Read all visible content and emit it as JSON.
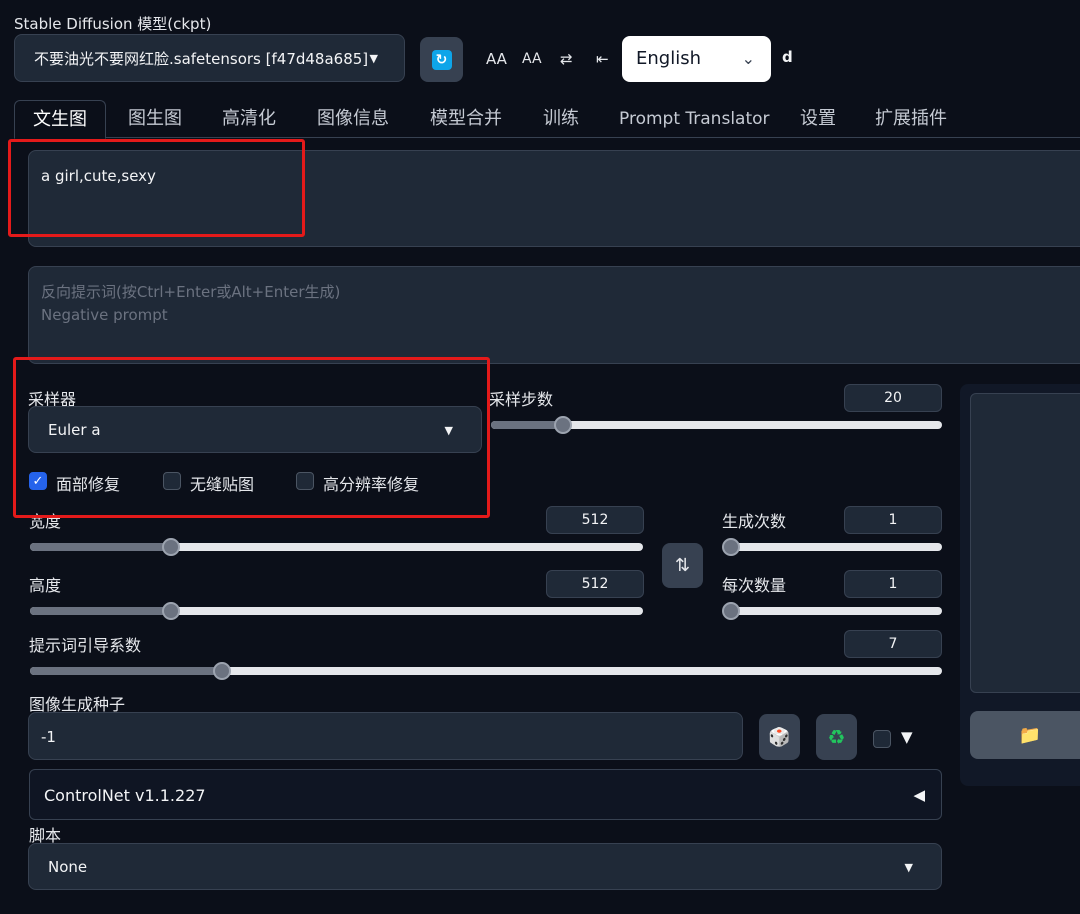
{
  "header": {
    "model_title": "Stable Diffusion 模型(ckpt)",
    "model_value": "不要油光不要网红脸.safetensors [f47d48a685]",
    "tool_icons": [
      "AA",
      "AA",
      "⇄",
      "⇤"
    ],
    "language": "English",
    "d_label": "d"
  },
  "tabs": [
    {
      "label": "文生图",
      "active": true
    },
    {
      "label": "图生图"
    },
    {
      "label": "高清化"
    },
    {
      "label": "图像信息"
    },
    {
      "label": "模型合并"
    },
    {
      "label": "训练"
    },
    {
      "label": "Prompt Translator"
    },
    {
      "label": "设置"
    },
    {
      "label": "扩展插件"
    }
  ],
  "prompt": {
    "value": "a girl,cute,sexy",
    "negative_placeholder_line1": "反向提示词(按Ctrl+Enter或Alt+Enter生成)",
    "negative_placeholder_line2": "Negative prompt"
  },
  "sampler": {
    "label": "采样器",
    "value": "Euler a",
    "steps_label": "采样步数",
    "steps_value": "20",
    "steps_fraction": 0.16
  },
  "checkboxes": [
    {
      "label": "面部修复",
      "checked": true
    },
    {
      "label": "无缝贴图",
      "checked": false
    },
    {
      "label": "高分辨率修复",
      "checked": false
    }
  ],
  "size": {
    "width_label": "宽度",
    "width_value": "512",
    "width_fraction": 0.23,
    "height_label": "高度",
    "height_value": "512",
    "height_fraction": 0.23,
    "swap_icon": "⇅"
  },
  "batch": {
    "count_label": "生成次数",
    "count_value": "1",
    "size_label": "每次数量",
    "size_value": "1"
  },
  "cfg": {
    "label": "提示词引导系数",
    "value": "7",
    "fraction": 0.21
  },
  "seed": {
    "label": "图像生成种子",
    "value": "-1",
    "dice_icon": "🎲",
    "recycle_icon": "♻",
    "extra_toggle": "▼"
  },
  "controlnet": {
    "label": "ControlNet v1.1.227",
    "toggle": "◀"
  },
  "script": {
    "label": "脚本",
    "value": "None"
  },
  "folder_icon": "📁",
  "colors": {
    "background": "#0b0f19",
    "panel": "#1f2937",
    "highlight_box": "#e41a1a",
    "checkbox_checked": "#2563eb"
  }
}
